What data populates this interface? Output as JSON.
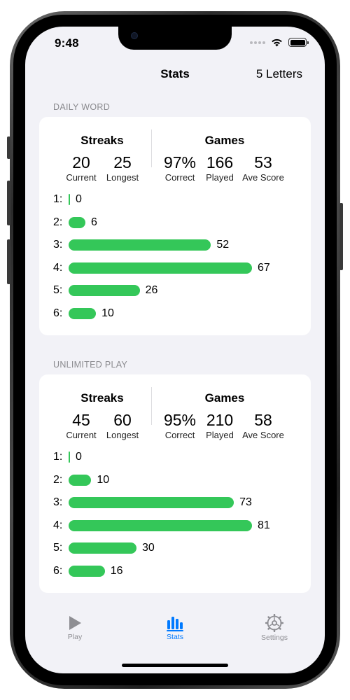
{
  "status_bar": {
    "time": "9:48"
  },
  "nav": {
    "title": "Stats",
    "right_label": "5 Letters"
  },
  "sections": [
    {
      "header": "DAILY WORD",
      "streaks": {
        "title": "Streaks",
        "current": "20",
        "current_label": "Current",
        "longest": "25",
        "longest_label": "Longest"
      },
      "games": {
        "title": "Games",
        "correct": "97%",
        "correct_label": "Correct",
        "played": "166",
        "played_label": "Played",
        "ave_score": "53",
        "ave_score_label": "Ave Score"
      },
      "distribution": [
        {
          "label": "1:",
          "count": 0
        },
        {
          "label": "2:",
          "count": 6
        },
        {
          "label": "3:",
          "count": 52
        },
        {
          "label": "4:",
          "count": 67
        },
        {
          "label": "5:",
          "count": 26
        },
        {
          "label": "6:",
          "count": 10
        }
      ]
    },
    {
      "header": "UNLIMITED PLAY",
      "streaks": {
        "title": "Streaks",
        "current": "45",
        "current_label": "Current",
        "longest": "60",
        "longest_label": "Longest"
      },
      "games": {
        "title": "Games",
        "correct": "95%",
        "correct_label": "Correct",
        "played": "210",
        "played_label": "Played",
        "ave_score": "58",
        "ave_score_label": "Ave Score"
      },
      "distribution": [
        {
          "label": "1:",
          "count": 0
        },
        {
          "label": "2:",
          "count": 10
        },
        {
          "label": "3:",
          "count": 73
        },
        {
          "label": "4:",
          "count": 81
        },
        {
          "label": "5:",
          "count": 30
        },
        {
          "label": "6:",
          "count": 16
        }
      ]
    }
  ],
  "tab_bar": {
    "tabs": [
      {
        "label": "Play",
        "icon": "play-icon",
        "active": false
      },
      {
        "label": "Stats",
        "icon": "bar-chart-icon",
        "active": true
      },
      {
        "label": "Settings",
        "icon": "gear-icon",
        "active": false
      }
    ]
  },
  "colors": {
    "bar": "#34c759",
    "accent": "#007aff",
    "inactive": "#8e8e93",
    "background": "#f2f2f7"
  }
}
